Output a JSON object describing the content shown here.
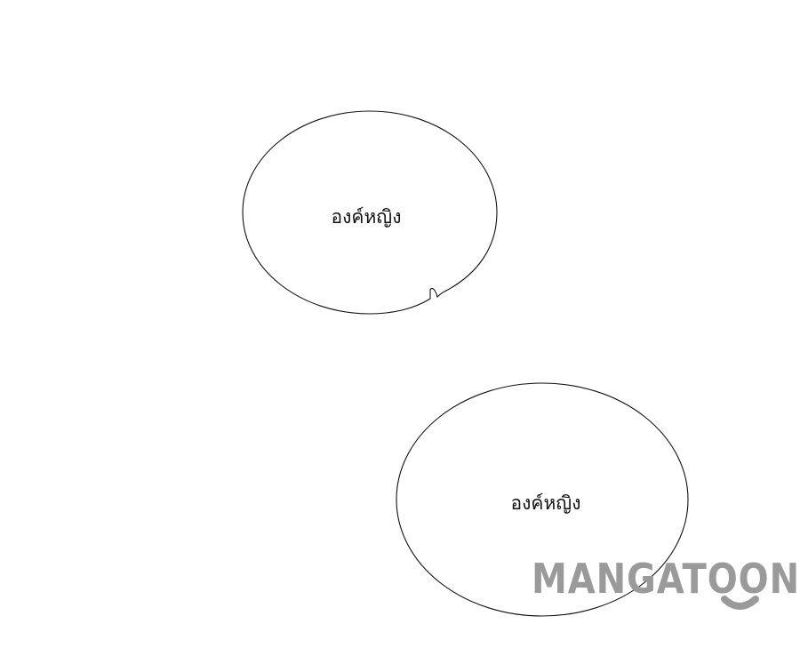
{
  "panel": {
    "bubbles": [
      {
        "text": "องค์หญิง"
      },
      {
        "text": "องค์หญิง"
      }
    ]
  },
  "watermark": {
    "text": "MANGATOON",
    "color": "#9a9a9a"
  }
}
